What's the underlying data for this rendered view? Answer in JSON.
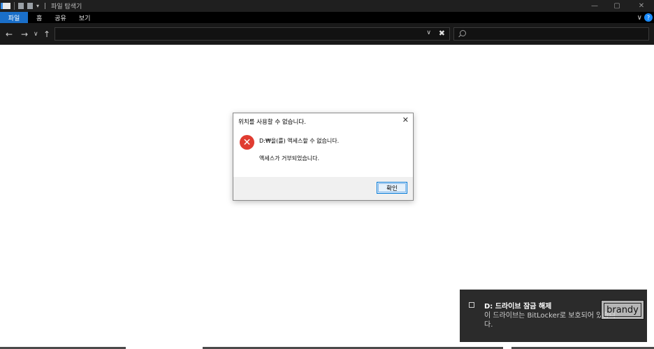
{
  "window": {
    "title": "파일 탐색기",
    "title_separator": "|",
    "quick_access_dropdown": "▾",
    "minimize": "—",
    "maximize": "▢",
    "close": "✕"
  },
  "ribbon": {
    "tabs": [
      {
        "label": "파일",
        "active": true
      },
      {
        "label": "홈"
      },
      {
        "label": "공유"
      },
      {
        "label": "보기"
      }
    ],
    "collapse_glyph": "∨",
    "help_glyph": "?"
  },
  "navigation": {
    "back": "←",
    "forward": "→",
    "recent": "∨",
    "up": "↑",
    "address_value": "",
    "address_dropdown": "∨",
    "refresh": "✖",
    "search_placeholder": ""
  },
  "dialog": {
    "title": "위치를 사용할 수 없습니다.",
    "close_glyph": "✕",
    "error_glyph": "✕",
    "message_primary": "D:₩을(를) 액세스할 수 없습니다.",
    "message_secondary": "액세스가 거부되었습니다.",
    "ok_label": "확인"
  },
  "toast": {
    "title": "D: 드라이브 잠금 해제",
    "body": "이 드라이브는 BitLocker로 보호되어 있습니다.",
    "watermark": "brandy"
  },
  "colors": {
    "accent": "#1a6fc9",
    "error": "#e03c31",
    "dark_bg": "#1f1f1f"
  }
}
